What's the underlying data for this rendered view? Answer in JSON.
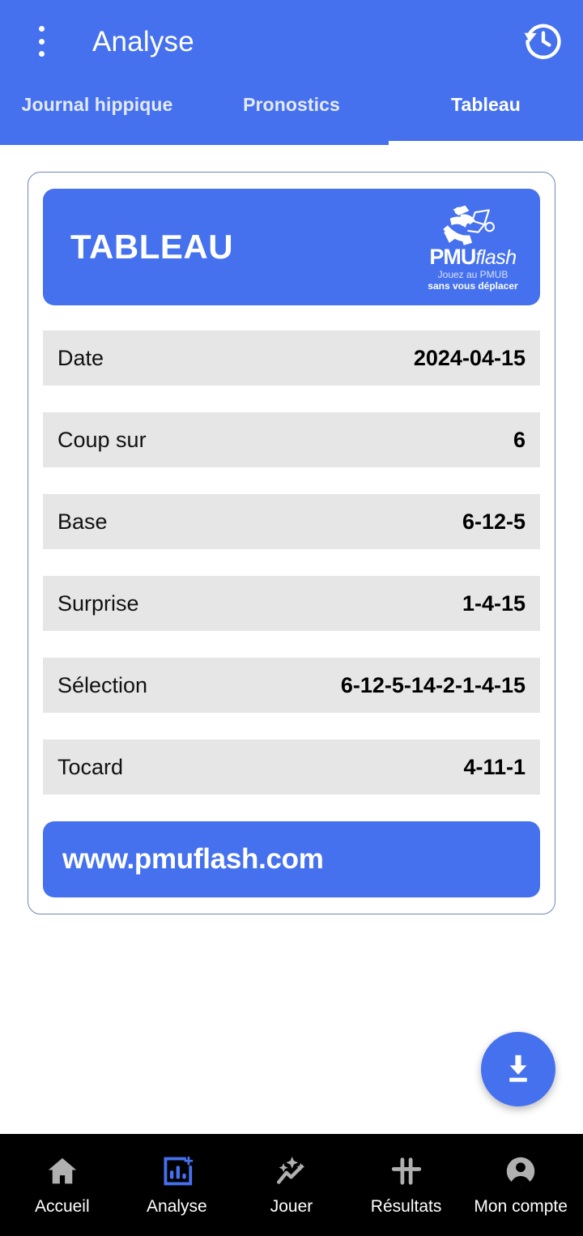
{
  "appbar": {
    "title": "Analyse",
    "overflow_icon": "more-vert-icon",
    "history_icon": "history-icon"
  },
  "tabs": [
    {
      "label": "Journal hippique",
      "active": false
    },
    {
      "label": "Pronostics",
      "active": false
    },
    {
      "label": "Tableau",
      "active": true
    }
  ],
  "card": {
    "banner_title": "TABLEAU",
    "logo": {
      "name": "pmuflash-logo",
      "word_primary": "PMU",
      "word_secondary": "flash",
      "tagline_line1": "Jouez au PMUB",
      "tagline_line2": "sans vous déplacer"
    },
    "rows": [
      {
        "label": "Date",
        "value": "2024-04-15"
      },
      {
        "label": "Coup sur",
        "value": "6"
      },
      {
        "label": "Base",
        "value": "6-12-5"
      },
      {
        "label": "Surprise",
        "value": "1-4-15"
      },
      {
        "label": "Sélection",
        "value": "6-12-5-14-2-1-4-15"
      },
      {
        "label": "Tocard",
        "value": "4-11-1"
      }
    ],
    "url": "www.pmuflash.com"
  },
  "fab": {
    "icon": "download-icon"
  },
  "bottomnav": [
    {
      "label": "Accueil",
      "icon": "home-icon",
      "active": false
    },
    {
      "label": "Analyse",
      "icon": "analytics-icon",
      "active": true
    },
    {
      "label": "Jouer",
      "icon": "sparkle-trend-icon",
      "active": false
    },
    {
      "label": "Résultats",
      "icon": "results-hash-icon",
      "active": false
    },
    {
      "label": "Mon compte",
      "icon": "account-icon",
      "active": false
    }
  ],
  "colors": {
    "brand_blue": "#4571EE",
    "row_grey": "#E6E6E6",
    "nav_black": "#000000",
    "nav_inactive": "#B0B0B0",
    "nav_active": "#4571EE",
    "card_border": "#6F86BA"
  }
}
